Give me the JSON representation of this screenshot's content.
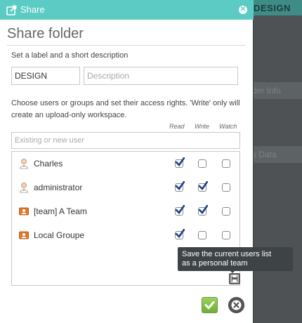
{
  "background": {
    "header_label": "DESIGN",
    "band_one_label": "der Info",
    "band_two_label": "s Data"
  },
  "dialog": {
    "title": "Share",
    "close_icon": "close-icon",
    "heading": "Share folder",
    "subtitle": "Set a label and a short description",
    "label_value": "DESIGN",
    "description_placeholder": "Description",
    "info": "Choose users or groups and set their access rights. 'Write' only will create an upload-only workspace.",
    "columns": {
      "read": "Read",
      "write": "Write",
      "watch": "Watch"
    },
    "user_placeholder": "Existing or new user",
    "users": [
      {
        "name": "Charles",
        "type": "user",
        "read": true,
        "write": false,
        "watch": false
      },
      {
        "name": "administrator",
        "type": "user",
        "read": true,
        "write": true,
        "watch": false
      },
      {
        "name": "[team] A Team",
        "type": "team",
        "read": true,
        "write": true,
        "watch": false
      },
      {
        "name": "Local Groupe",
        "type": "group",
        "read": true,
        "write": false,
        "watch": false
      }
    ],
    "tooltip_line1": "Save the current users list",
    "tooltip_line2": "as a personal team",
    "accent_color": "#5ccbc4",
    "ok_color": "#6fae34"
  }
}
